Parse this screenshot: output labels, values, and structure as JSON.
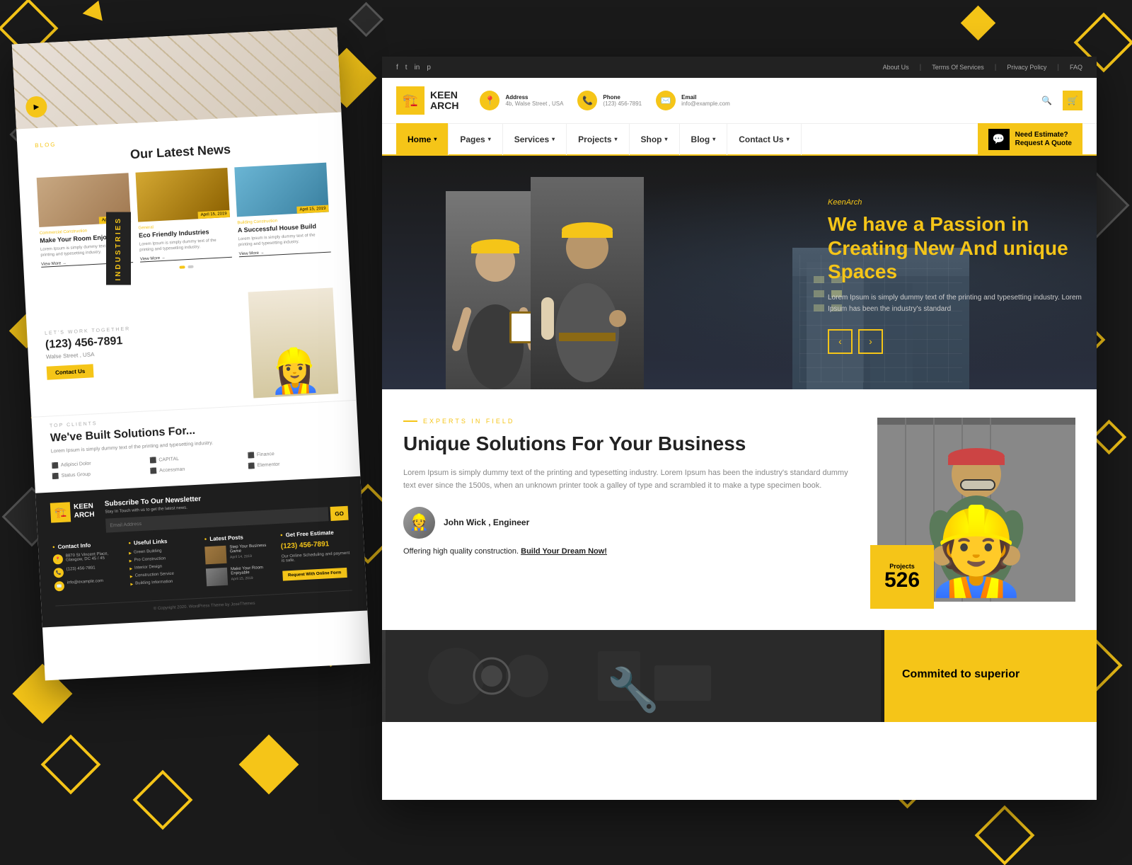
{
  "background": {
    "color": "#1a1a1a"
  },
  "topbar": {
    "social_icons": [
      "f",
      "t",
      "in",
      "p"
    ],
    "links": [
      "About Us",
      "Terms Of Services",
      "Privacy Policy",
      "FAQ"
    ]
  },
  "header": {
    "logo_name": "KEEN\nARCH",
    "logo_icon": "🏗️",
    "address_label": "Address",
    "address_value": "4b, Walse Street , USA",
    "phone_label": "Phone",
    "phone_value": "(123) 456-7891",
    "email_label": "Email",
    "email_value": "info@example.com",
    "cta_label": "Need Estimate?\nRequest A Quote"
  },
  "nav": {
    "items": [
      "Home",
      "Pages",
      "Services",
      "Projects",
      "Shop",
      "Blog",
      "Contact Us"
    ],
    "active": "Home",
    "arrows": [
      "Home",
      "Pages",
      "Services",
      "Projects",
      "Shop",
      "Blog",
      "Contact Us"
    ]
  },
  "hero": {
    "brand": "KeenArch",
    "title": "We have a Passion in Creating New And unique Spaces",
    "description": "Lorem Ipsum is simply dummy text of the printing and typesetting industry. Lorem Ipsum has been the industry's standard",
    "prev_label": "‹",
    "next_label": "›"
  },
  "experts": {
    "tag": "EXPERTS IN FIELD",
    "title": "Unique Solutions For Your Business",
    "description": "Lorem Ipsum is simply dummy text of the printing and typesetting industry. Lorem Ipsum has been the industry's standard dummy text ever since the 1500s, when an unknown printer took a galley of type and scrambled it to make a type specimen book.",
    "profile_name": "John Wick , Engineer",
    "profile_title": "",
    "quote": "Offering high quality construction.",
    "build_link": "Build Your Dream Now!",
    "projects_label": "Projects",
    "projects_count": "526"
  },
  "left_page": {
    "blog_title": "Our Latest News",
    "blog_label": "BLOG",
    "cards": [
      {
        "date": "April 15, 2019",
        "category": "Commercial Construction",
        "title": "Make Your Room Enjoyable",
        "text": "Lorem Ipsum is simply dummy text of the printing and typesetting industry.",
        "view_more": "View More"
      },
      {
        "date": "April 15, 2019",
        "category": "General",
        "title": "Eco Friendly Industries",
        "text": "Lorem Ipsum is simply dummy text of the printing and typesetting industry.",
        "view_more": "View More"
      },
      {
        "date": "April 15, 2019",
        "category": "Building Construction",
        "title": "A Successful House Build",
        "text": "Lorem Ipsum is simply dummy text of the printing and typesetting industry.",
        "view_more": "View More"
      }
    ],
    "cta_label": "LET'S WORK TOGETHER",
    "cta_phone": "(123) 456-7891",
    "cta_address": "Walse Street , USA",
    "contact_btn": "Contact Us",
    "solutions_label": "TOP CLIENTS",
    "solutions_title": "We've Built Solutions For...",
    "solutions_text": "Lorem Ipsum is simply dummy text of the printing and typesetting industry.",
    "clients": [
      "Adipisci Dolor",
      "CAPITAL",
      "Finance",
      "Status Group",
      "Accessman",
      "Elementor"
    ],
    "footer": {
      "logo": "KEEN ARCH",
      "newsletter_title": "Subscribe To Our Newsletter",
      "newsletter_sub": "Stay In Touch with us to get the latest news.",
      "newsletter_placeholder": "Email Address",
      "newsletter_btn": "GO",
      "contact_title": "Contact Info",
      "contact_items": [
        "8870 St Vincent Place, Glasgow, DC 45 / 45",
        "(123) 456-7891",
        "info@example.com"
      ],
      "useful_title": "Useful Links",
      "useful_items": [
        "Green Building",
        "Pro Construction",
        "Interior Design",
        "Construction Service",
        "Building Information"
      ],
      "posts_title": "Latest Posts",
      "posts": [
        {
          "title": "Step Your Business Game",
          "date": "April 14, 2019"
        },
        {
          "title": "Make Your Room Enjoyable",
          "date": "April 15, 2019"
        }
      ],
      "estimate_title": "Get Free Estimate",
      "estimate_phone": "(123) 456-7891",
      "estimate_text": "Our Online Scheduling and payment is safe.",
      "estimate_btn": "Request With Online Form",
      "copyright": "© Copyright 2020. WordPress Theme by JoseThemes"
    }
  },
  "bottom": {
    "title": "Commited to superior"
  },
  "industries_label": "Industries"
}
